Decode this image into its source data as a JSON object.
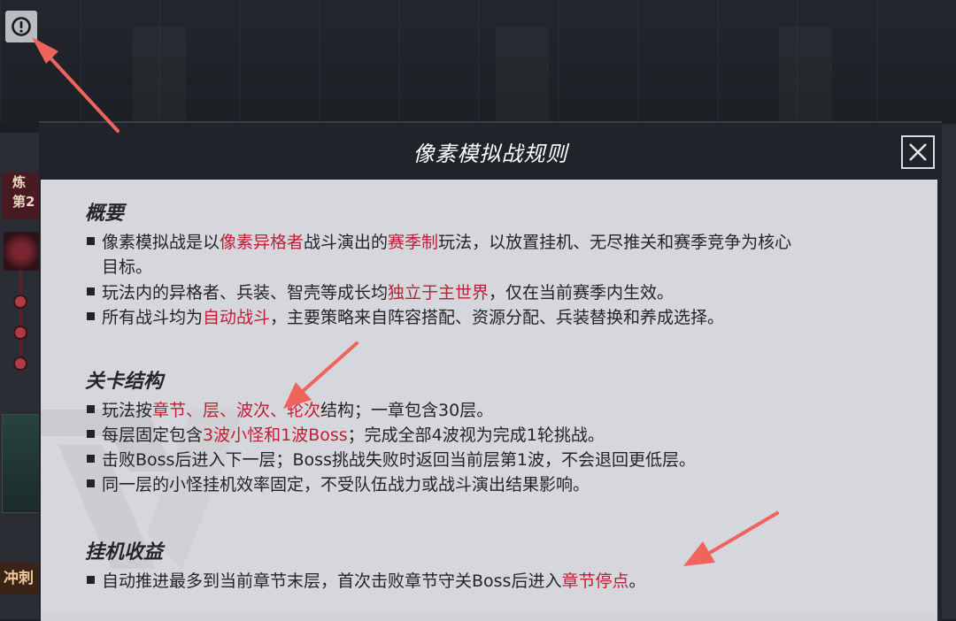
{
  "dialog": {
    "title": "像素模拟战规则",
    "sections": [
      {
        "heading": "概要",
        "items": [
          {
            "p1": "像素模拟战是以",
            "h1": "像素异格者",
            "p2": "战斗演出的",
            "h2": "赛季制",
            "p3": "玩法，以放置挂机、无尽推关和赛季竞争为核心",
            "p4": "目标。"
          },
          {
            "p1": "玩法内的异格者、兵装、智壳等成长均",
            "h1": "独立于主世界",
            "p2": "，仅在当前赛季内生效。"
          },
          {
            "p1": "所有战斗均为",
            "h1": "自动战斗",
            "p2": "，主要策略来自阵容搭配、资源分配、兵装替换和养成选择。"
          }
        ]
      },
      {
        "heading": "关卡结构",
        "items": [
          {
            "p1": "玩法按",
            "h1": "章节、层、波次、轮次",
            "p2": "结构；一章包含30层。"
          },
          {
            "p1": "每层固定包含",
            "h1": "3波小怪和1波Boss",
            "p2": "；完成全部4波视为完成1轮挑战。"
          },
          {
            "p1": "击败Boss后进入下一层；Boss挑战失败时返回当前层第1波，不会退回更低层。"
          },
          {
            "p1": "同一层的小怪挂机效率固定，不受队伍战力或战斗演出结果影响。"
          }
        ]
      },
      {
        "heading": "挂机收益",
        "items": [
          {
            "p1": "自动推进最多到当前章节末层，首次击败章节守关Boss后进入",
            "h1": "章节停点",
            "p2": "。"
          }
        ]
      }
    ]
  },
  "side": {
    "tag_line1": "炼",
    "tag_line2": "第2",
    "bottom_label": "冲刺"
  },
  "colors": {
    "highlight": "#c01e35",
    "arrow": "#f0645e"
  },
  "icons": {
    "info": "exclamation-circle-icon",
    "close": "close-icon"
  }
}
